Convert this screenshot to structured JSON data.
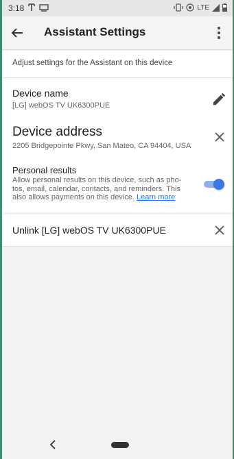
{
  "status": {
    "time": "3:18",
    "network": "LTE"
  },
  "appbar": {
    "title": "Assistant Settings"
  },
  "description": "Adjust settings for the Assistant on this device",
  "device_name": {
    "label": "Device name",
    "value": "[LG] webOS TV UK6300PUE"
  },
  "device_address": {
    "label": "Device address",
    "value": "2205 Bridgepointe Pkwy, San Mateo, CA 94404, USA"
  },
  "personal_results": {
    "label": "Personal results",
    "line1": "Allow personal results on this device, such as pho-",
    "line2": "tos, email, calendar, contacts, and reminders. This",
    "line3": "also allows payments on this device.",
    "link": "Learn more",
    "enabled": true
  },
  "unlink": {
    "label": "Unlink [LG] webOS TV UK6300PUE"
  }
}
